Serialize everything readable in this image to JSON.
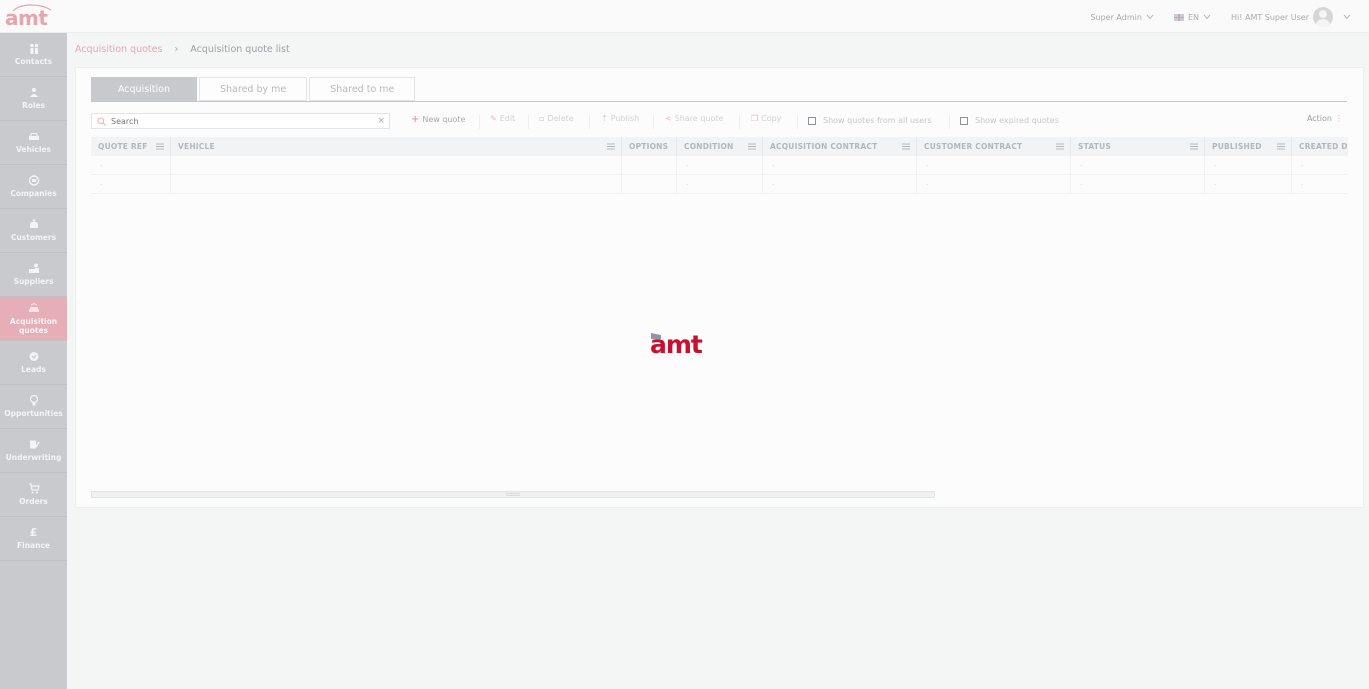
{
  "app": {
    "logo_text": "amt",
    "loader_text": "amt"
  },
  "header": {
    "role": "Super Admin",
    "language": "EN",
    "greeting": "Hi! AMT Super User"
  },
  "sidebar": {
    "items": [
      {
        "label": "Contacts",
        "icon": "contacts-icon"
      },
      {
        "label": "Roles",
        "icon": "roles-icon"
      },
      {
        "label": "Vehicles",
        "icon": "car-icon"
      },
      {
        "label": "Companies",
        "icon": "companies-icon"
      },
      {
        "label": "Customers",
        "icon": "customers-icon"
      },
      {
        "label": "Suppliers",
        "icon": "suppliers-icon"
      },
      {
        "label": "Acquisition quotes",
        "icon": "acquisition-quotes-icon",
        "active": true
      },
      {
        "label": "Leads",
        "icon": "leads-icon"
      },
      {
        "label": "Opportunities",
        "icon": "opportunities-icon"
      },
      {
        "label": "Underwriting",
        "icon": "underwriting-icon"
      },
      {
        "label": "Orders",
        "icon": "orders-icon"
      },
      {
        "label": "Finance",
        "icon": "pound-icon",
        "glyph": "£"
      }
    ]
  },
  "breadcrumb": {
    "parent": "Acquisition quotes",
    "separator": "›",
    "current": "Acquisition quote list"
  },
  "tabs": [
    {
      "label": "Acquisition",
      "active": true
    },
    {
      "label": "Shared by me"
    },
    {
      "label": "Shared to me"
    }
  ],
  "toolbar": {
    "search_placeholder": "Search",
    "clear": "×",
    "new_quote": "New quote",
    "edit": "Edit",
    "delete": "Delete",
    "publish": "Publish",
    "share_quote": "Share quote",
    "copy": "Copy",
    "show_all_users": "Show quotes from all users",
    "show_expired": "Show expired quotes",
    "action": "Action",
    "action_dots": "⋮"
  },
  "grid": {
    "columns": [
      "QUOTE REF",
      "VEHICLE",
      "OPTIONS",
      "CONDITION",
      "ACQUISITION CONTRACT",
      "CUSTOMER CONTRACT",
      "STATUS",
      "PUBLISHED",
      "CREATED D"
    ],
    "rows": [
      [
        "-",
        "",
        "",
        "-",
        "-",
        "-",
        "-",
        "-",
        "-"
      ],
      [
        "-",
        "",
        "",
        "-",
        "-",
        "-",
        "-",
        "-",
        "-"
      ]
    ]
  },
  "colors": {
    "accent": "#c8102e",
    "sidebar": "#c8cacd",
    "active_item": "#e6aeb7"
  }
}
